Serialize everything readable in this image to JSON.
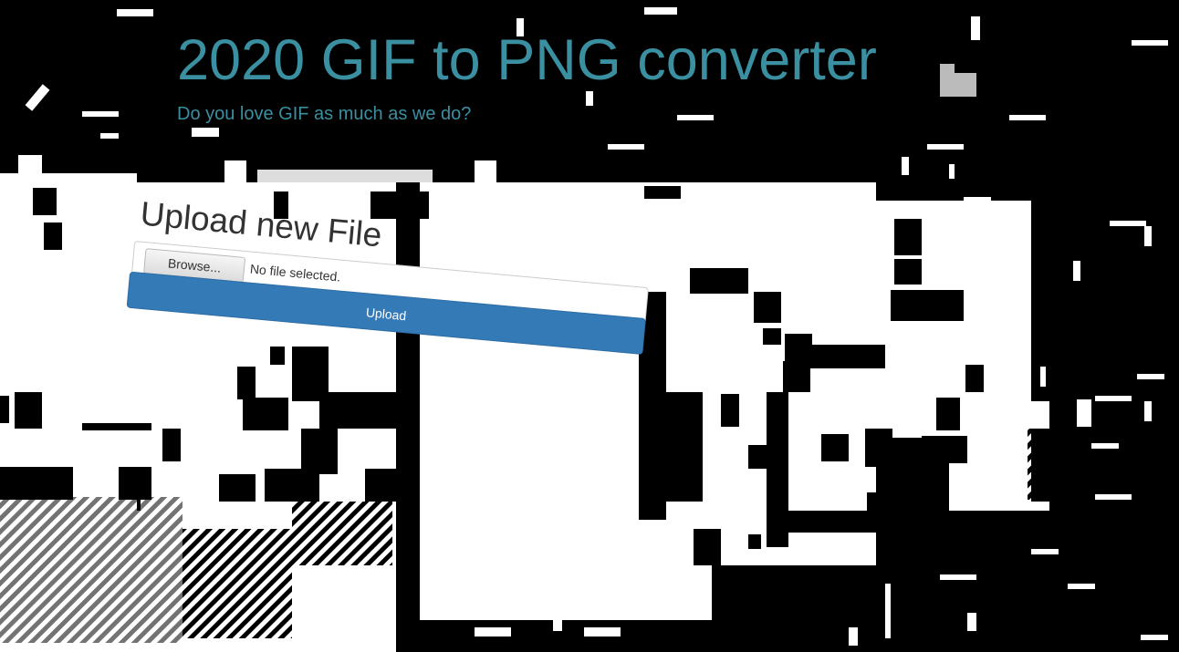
{
  "header": {
    "title": "2020 GIF to PNG converter",
    "subtitle": "Do you love GIF as much as we do?"
  },
  "upload_form": {
    "heading": "Upload new File",
    "browse_label": "Browse...",
    "file_status": "No file selected.",
    "submit_label": "Upload"
  },
  "colors": {
    "heading_accent": "#3a8fa0",
    "button_primary": "#337ab7",
    "background": "#000000"
  }
}
